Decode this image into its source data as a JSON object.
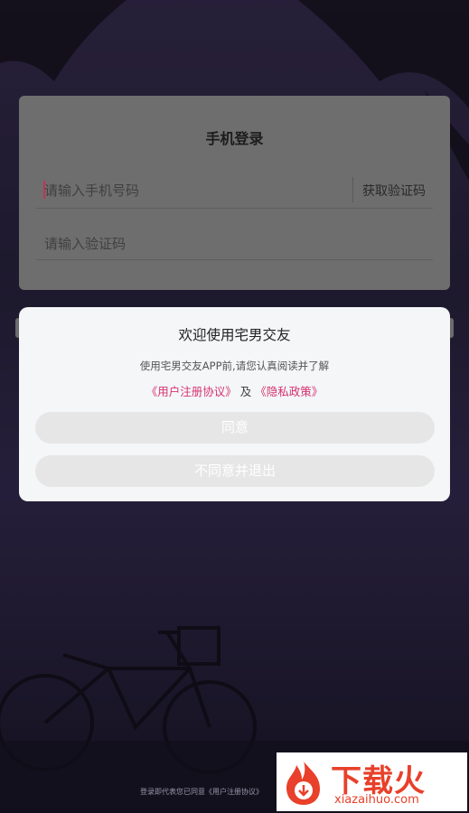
{
  "login": {
    "title": "手机登录",
    "phone_placeholder": "请输入手机号码",
    "get_code": "获取验证码",
    "code_placeholder": "请输入验证码"
  },
  "dialog": {
    "title": "欢迎使用宅男交友",
    "description": "使用宅男交友APP前,请您认真阅读并了解",
    "user_agreement": "《用户注册协议》",
    "and": "及",
    "privacy_policy": "《隐私政策》",
    "agree": "同意",
    "disagree_exit": "不同意并退出"
  },
  "footer": {
    "notice": "登录即代表您已同意《用户注册协议》"
  },
  "watermark": {
    "name": "下载火",
    "url": "xiazaihuo.com"
  },
  "colors": {
    "accent_link": "#d6336c",
    "watermark": "#e8402a"
  }
}
